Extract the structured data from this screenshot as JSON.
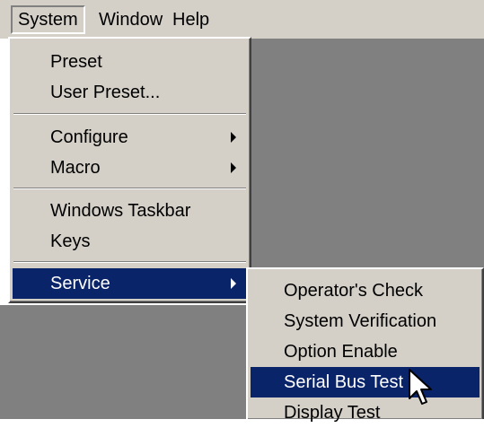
{
  "menubar": {
    "items": [
      {
        "label": "System"
      },
      {
        "label": "Window"
      },
      {
        "label": "Help"
      }
    ]
  },
  "system_menu": {
    "items": [
      {
        "label": "Preset"
      },
      {
        "label": "User Preset..."
      },
      {
        "label": "Configure"
      },
      {
        "label": "Macro"
      },
      {
        "label": "Windows Taskbar"
      },
      {
        "label": "Keys"
      },
      {
        "label": "Service"
      }
    ],
    "selected": "Service"
  },
  "service_submenu": {
    "items": [
      {
        "label": "Operator's Check"
      },
      {
        "label": "System Verification"
      },
      {
        "label": "Option Enable"
      },
      {
        "label": "Serial Bus Test"
      },
      {
        "label": "Display Test"
      }
    ],
    "selected": "Serial Bus Test"
  },
  "colors": {
    "face": "#d4d0c8",
    "desktop": "#808080",
    "highlight": "#0a246a",
    "highlight_text": "#ffffff"
  },
  "cursor": {
    "icon": "arrow-pointer-icon"
  }
}
